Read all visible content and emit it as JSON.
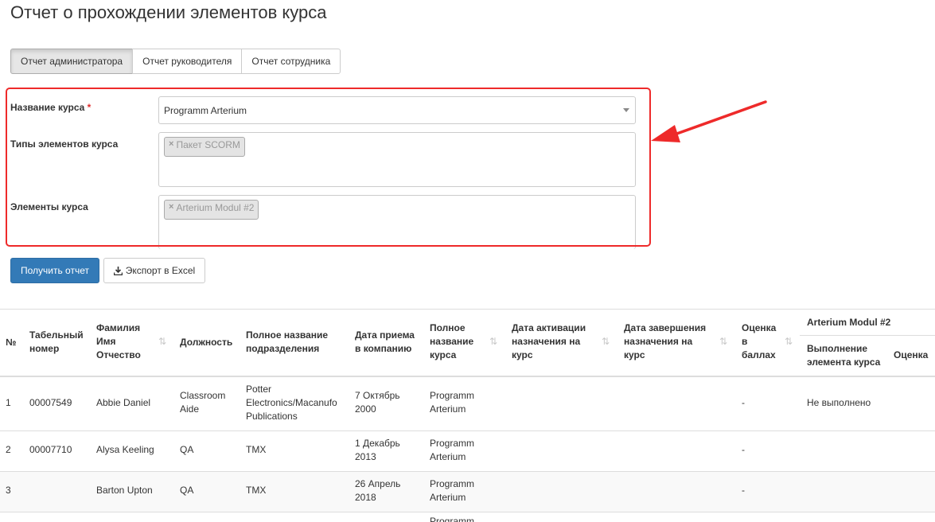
{
  "page": {
    "title": "Отчет о прохождении элементов курса"
  },
  "tabs": [
    {
      "label": "Отчет администратора",
      "active": true
    },
    {
      "label": "Отчет руководителя",
      "active": false
    },
    {
      "label": "Отчет сотрудника",
      "active": false
    }
  ],
  "form": {
    "course_name": {
      "label": "Название курса",
      "required_mark": "*",
      "value": "Programm Arterium"
    },
    "element_types": {
      "label": "Типы элементов курса",
      "tags": [
        "Пакет SCORM"
      ]
    },
    "elements": {
      "label": "Элементы курса",
      "tags": [
        "Arterium Modul #2"
      ]
    },
    "highlight_color": "#ee2a2a"
  },
  "buttons": {
    "get_report": "Получить отчет",
    "export_excel": "Экспорт в Excel",
    "primary_color": "#337ab7"
  },
  "table": {
    "headers": {
      "num": "№",
      "tab_number": [
        "Табельный",
        "номер"
      ],
      "full_name": [
        "Фамилия",
        "Имя",
        "Отчество"
      ],
      "position": "Должность",
      "department": [
        "Полное название",
        "подразделения"
      ],
      "hire_date": [
        "Дата приема",
        "в компанию"
      ],
      "course": [
        "Полное",
        "название",
        "курса"
      ],
      "activation_date": [
        "Дата активации",
        "назначения на",
        "курс"
      ],
      "completion_date": [
        "Дата завершения",
        "назначения на",
        "курс"
      ],
      "score": [
        "Оценка",
        "в",
        "баллах"
      ],
      "group": "Arterium Modul #2",
      "element_completion": [
        "Выполнение",
        "элемента курса"
      ],
      "grade": "Оценка"
    },
    "rows": [
      {
        "num": "1",
        "tab_number": "00007549",
        "full_name": "Abbie Daniel",
        "position": [
          "Classroom",
          "Aide"
        ],
        "department": [
          "Potter",
          "Electronics/Macanufo",
          "Publications"
        ],
        "hire_date": [
          "7 Октябрь",
          "2000"
        ],
        "course": [
          "Programm",
          "Arterium"
        ],
        "score": "-",
        "element_completion": "Не выполнено"
      },
      {
        "num": "2",
        "tab_number": "00007710",
        "full_name": "Alysa Keeling",
        "position": [
          "QA"
        ],
        "department": [
          "TMX"
        ],
        "hire_date": [
          "1 Декабрь",
          "2013"
        ],
        "course": [
          "Programm",
          "Arterium"
        ],
        "score": "-",
        "element_completion": ""
      },
      {
        "num": "3",
        "tab_number": "",
        "full_name": "Barton Upton",
        "position": [
          "QA"
        ],
        "department": [
          "TMX"
        ],
        "hire_date": [
          "26 Апрель",
          "2018"
        ],
        "course": [
          "Programm",
          "Arterium"
        ],
        "score": "-",
        "element_completion": ""
      }
    ],
    "partial_row_text": "Programm"
  }
}
